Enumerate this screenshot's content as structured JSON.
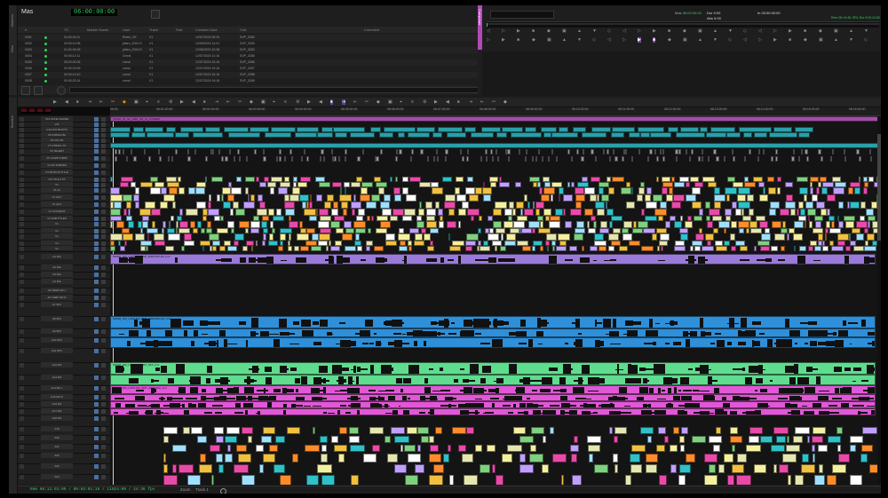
{
  "marker_window": {
    "title": "Mas",
    "timecode": "06:00:00:00",
    "columns": [
      "#",
      "",
      "TC",
      "Marker Name",
      "User",
      "Track",
      "Part",
      "Creation Date",
      "Clrd",
      "Comment"
    ],
    "rows": [
      [
        "0001",
        "04:00:00:11",
        "Rnew_CE",
        "V1",
        "12/07/2024 09:20",
        "SVP_3282"
      ],
      [
        "0002",
        "00:00:10:06",
        "jdhen_2024 D",
        "V1",
        "12/06/2024 14:01",
        "SVP_3283"
      ],
      [
        "0003",
        "01:02:04:09",
        "jdhen_2024 D",
        "V1",
        "12/06/2024 10:08",
        "SVP_3284"
      ],
      [
        "0004",
        "00:00:12:11",
        "Cmnd",
        "V1",
        "12/07/2024 11:16",
        "SVP_3285"
      ],
      [
        "0005",
        "06:00:00:06",
        "cmnd",
        "V1",
        "12/07/2024 19:16",
        "SVP_3286"
      ],
      [
        "0006",
        "00:00:15:09",
        "cmnd",
        "V1",
        "12/07/2024 19:16",
        "SVP_3287"
      ],
      [
        "0007",
        "00:00:19:10",
        "cmnd",
        "V1",
        "12/07/2024 19:16",
        "SVP_3288"
      ],
      [
        "0008",
        "00:00:20:14",
        "cmnd",
        "V1",
        "12/07/2024 19:16",
        "SVP_3289"
      ]
    ]
  },
  "record_monitor": {
    "tab_label": "Composer",
    "mas_label": "Mas",
    "mas_tc": "06:00:00:00",
    "dur_label": "Dur",
    "dur_value": "0:00",
    "in_label": "In",
    "in_tc": "00:00:00:00",
    "abs_label": "Abs",
    "abs_value": "0:00",
    "sequence_info": "Rem 06:14:45; SRL Dur 0:00:14:53"
  },
  "timeline": {
    "master_tc": "00:00:00:00",
    "ruler_ticks": [
      "06:00",
      "06:01:00:00",
      "06:02:00:00",
      "06:03:00:00",
      "06:04:00:00",
      "06:05:00:00",
      "06:06:00:00",
      "06:07:00:00",
      "06:08:00:00",
      "06:09:00:00",
      "06:10:00:00",
      "06:11:00:00",
      "06:12:00:00",
      "06:13:00:00",
      "06:14:00:00",
      "06:15:00:00",
      "06:16:00:00"
    ],
    "video_tracks": [
      "V12 CPHel SHADE",
      "V11",
      "V10 CNT BOOTS",
      "V9 STRING Bn",
      "V8 VFX Bn",
      "V7 STRING TS",
      "V6 TELEMT",
      "V5 LOWR THIRD",
      "V4 AN SUBTER",
      "V3 MOTION TITLE",
      "V2 TITLE TXT",
      "V1",
      "V1 HL",
      "V1 GFX",
      "V1 GFX",
      "V1 CONTENT",
      "V1 SUB TITLES",
      "V1",
      "V1",
      "V1",
      "V1",
      "V1"
    ],
    "audio_tracks": [
      "A1 DIA",
      "A2 DIA",
      "A3 DIA",
      "A4 DIA",
      "A5 TEMP MX L",
      "A6 TEMP MX R",
      "A7 SFX",
      "A8 SFX",
      "A9 SFX",
      "A10 SFX",
      "A11 SFX",
      "A12 MX",
      "A13 MX",
      "A14 MX L",
      "A15 MX R",
      "A16 MX",
      "A17 MX",
      "A18 MX",
      "A19",
      "A20",
      "A21",
      "A22",
      "A23",
      "A24"
    ],
    "sequence_clip": "SWGR_03_SF_HMR_CR_v3_LCDEEIT",
    "audio_clip_a": "SWGR_HM_LCDS DX_RMT_ENDIT0C.EA_hmr",
    "audio_clip_b": "SWGR_HM_LCDS DX_RMT_2ND0S0C.EA_hmr",
    "audio_clip_c": "SWGR_HM_LCDS FX_RMT_SFX_hmr",
    "audio_clip_d": "SWGR_HM_LCDS MX_RMT_2ND0S0C_hmr"
  },
  "status_bar": {
    "tc": "Rem 06:12:01:09 / 00:03:01:19 / 11024:00 / 24:36 fps",
    "zoom_label": "Zoom",
    "track_label": "Track 1"
  },
  "icons": [
    "gear-icon",
    "play-icon",
    "stop-icon",
    "mark-in-icon",
    "mark-out-icon",
    "splice-icon",
    "overwrite-icon",
    "lift-icon",
    "extract-icon",
    "snap-icon",
    "settings-icon"
  ],
  "colors": {
    "accent_purple": "#a14ea6",
    "timecode_green": "#30d158",
    "clip_teal": "#2a9fa8",
    "audio_blue": "#2f8fd8",
    "audio_green": "#5fdc8e",
    "audio_pink": "#e058d6"
  }
}
